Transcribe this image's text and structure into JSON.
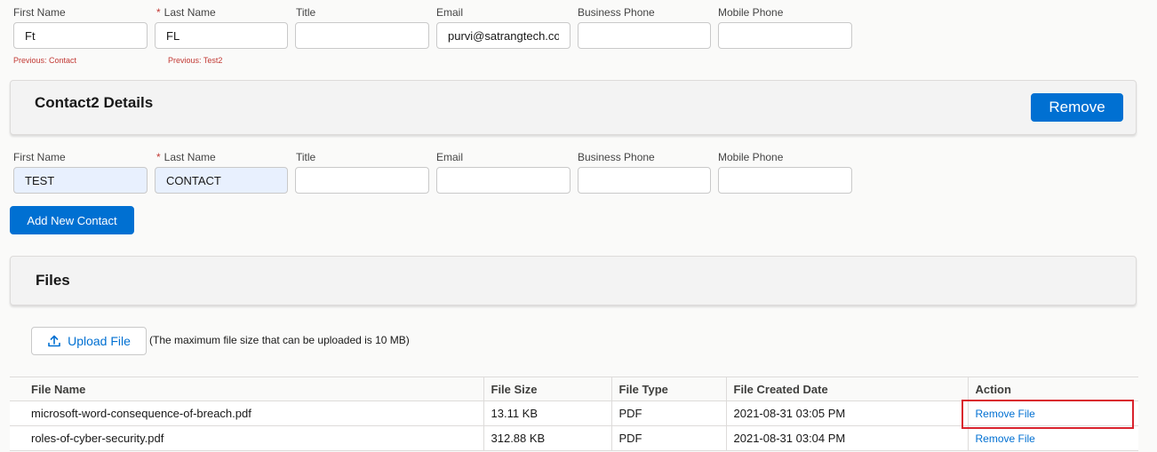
{
  "contact1": {
    "labels": {
      "first_name": "First Name",
      "last_name": "Last Name",
      "title": "Title",
      "email": "Email",
      "business_phone": "Business Phone",
      "mobile_phone": "Mobile Phone"
    },
    "values": {
      "first_name": "Ft",
      "last_name": "FL",
      "title": "",
      "email": "purvi@satrangtech.com",
      "business_phone": "",
      "mobile_phone": ""
    },
    "previous": {
      "first_name": "Previous: Contact",
      "last_name": "Previous: Test2"
    }
  },
  "contact2": {
    "section_title": "Contact2 Details",
    "remove_label": "Remove",
    "labels": {
      "first_name": "First Name",
      "last_name": "Last Name",
      "title": "Title",
      "email": "Email",
      "business_phone": "Business Phone",
      "mobile_phone": "Mobile Phone"
    },
    "values": {
      "first_name": "TEST",
      "last_name": "CONTACT",
      "title": "",
      "email": "",
      "business_phone": "",
      "mobile_phone": ""
    }
  },
  "required_marker": "*",
  "add_contact_label": "Add New Contact",
  "files": {
    "section_title": "Files",
    "upload_label": "Upload File",
    "upload_note": "(The maximum file size that can be uploaded is 10 MB)",
    "columns": [
      "File Name",
      "File Size",
      "File Type",
      "File Created Date",
      "Action"
    ],
    "rows": [
      {
        "name": "microsoft-word-consequence-of-breach.pdf",
        "size": "13.11 KB",
        "type": "PDF",
        "created": "2021-08-31 03:05 PM",
        "action": "Remove File"
      },
      {
        "name": "roles-of-cyber-security.pdf",
        "size": "312.88 KB",
        "type": "PDF",
        "created": "2021-08-31 03:04 PM",
        "action": "Remove File"
      }
    ]
  },
  "colors": {
    "brand": "#0070d2",
    "required": "#c23934",
    "highlight": "#d9232d",
    "filled_input": "#e8f0fe"
  },
  "icons": {
    "upload": "upload-icon"
  }
}
